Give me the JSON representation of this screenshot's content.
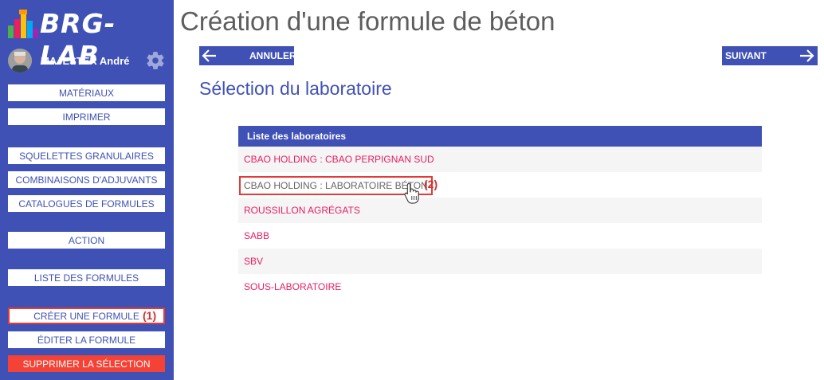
{
  "app": {
    "logo_text": "BRG-LAB",
    "user_name": "MAJESTER André"
  },
  "sidebar": {
    "items": [
      {
        "label": "MATÉRIAUX"
      },
      {
        "label": "IMPRIMER"
      },
      {
        "label": "SQUELETTES GRANULAIRES"
      },
      {
        "label": "COMBINAISONS D'ADJUVANTS"
      },
      {
        "label": "CATALOGUES DE FORMULES"
      },
      {
        "label": "ACTION"
      },
      {
        "label": "LISTE DES FORMULES"
      },
      {
        "label": "CRÉER UNE FORMULE"
      },
      {
        "label": "ÉDITER LA FORMULE"
      },
      {
        "label": "SUPPRIMER LA SÉLECTION"
      }
    ],
    "annotation": "(1)"
  },
  "main": {
    "title": "Création d'une formule de béton",
    "cancel_label": "ANNULER",
    "next_label": "SUIVANT",
    "section_title": "Sélection du laboratoire",
    "table": {
      "header": "Liste des laboratoires",
      "rows": [
        "CBAO HOLDING : CBAO PERPIGNAN SUD",
        "CBAO HOLDING : LABORATOIRE BÉTON",
        "ROUSSILLON AGRÉGATS",
        "SABB",
        "SBV",
        "SOUS-LABORATOIRE"
      ]
    },
    "annotation": "(2)"
  },
  "colors": {
    "primary": "#3f51b5",
    "danger": "#f44336",
    "link": "#e91e63",
    "annotation": "#e53935"
  },
  "icons": [
    "gear-icon",
    "arrow-left-icon",
    "arrow-right-icon",
    "hand-cursor-icon",
    "logo-icon"
  ]
}
